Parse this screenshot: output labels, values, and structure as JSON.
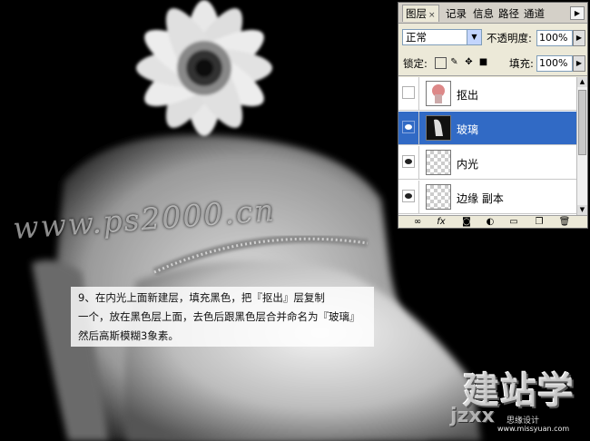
{
  "image": {
    "watermark": "www.ps2000.cn",
    "caption_lines": [
      "9、在内光上面新建层，填充黑色，把『抠出』层复制",
      "一个，放在黑色层上面，去色后跟黑色层合并命名为『玻璃』",
      "然后高斯模糊3象素。"
    ],
    "logo": {
      "big": "建站学",
      "small": "jzxx",
      "tiny": "思缘设计",
      "url": "www.missyuan.com"
    }
  },
  "panel": {
    "tabs": [
      "图层",
      "记录",
      "信息",
      "路径",
      "通道"
    ],
    "tab_close": "×",
    "blend_mode": "正常",
    "opacity_label": "不透明度:",
    "opacity_value": "100%",
    "lock_label": "锁定:",
    "fill_label": "填充:",
    "fill_value": "100%",
    "layers": [
      {
        "name": "抠出",
        "visible": false,
        "selected": false
      },
      {
        "name": "玻璃",
        "visible": true,
        "selected": true
      },
      {
        "name": "内光",
        "visible": true,
        "selected": false
      },
      {
        "name": "边缘 副本",
        "visible": true,
        "selected": false
      }
    ],
    "bottom_icons": [
      "link-icon",
      "fx-icon",
      "mask-icon",
      "adjustment-icon",
      "folder-icon",
      "new-layer-icon",
      "trash-icon"
    ]
  }
}
